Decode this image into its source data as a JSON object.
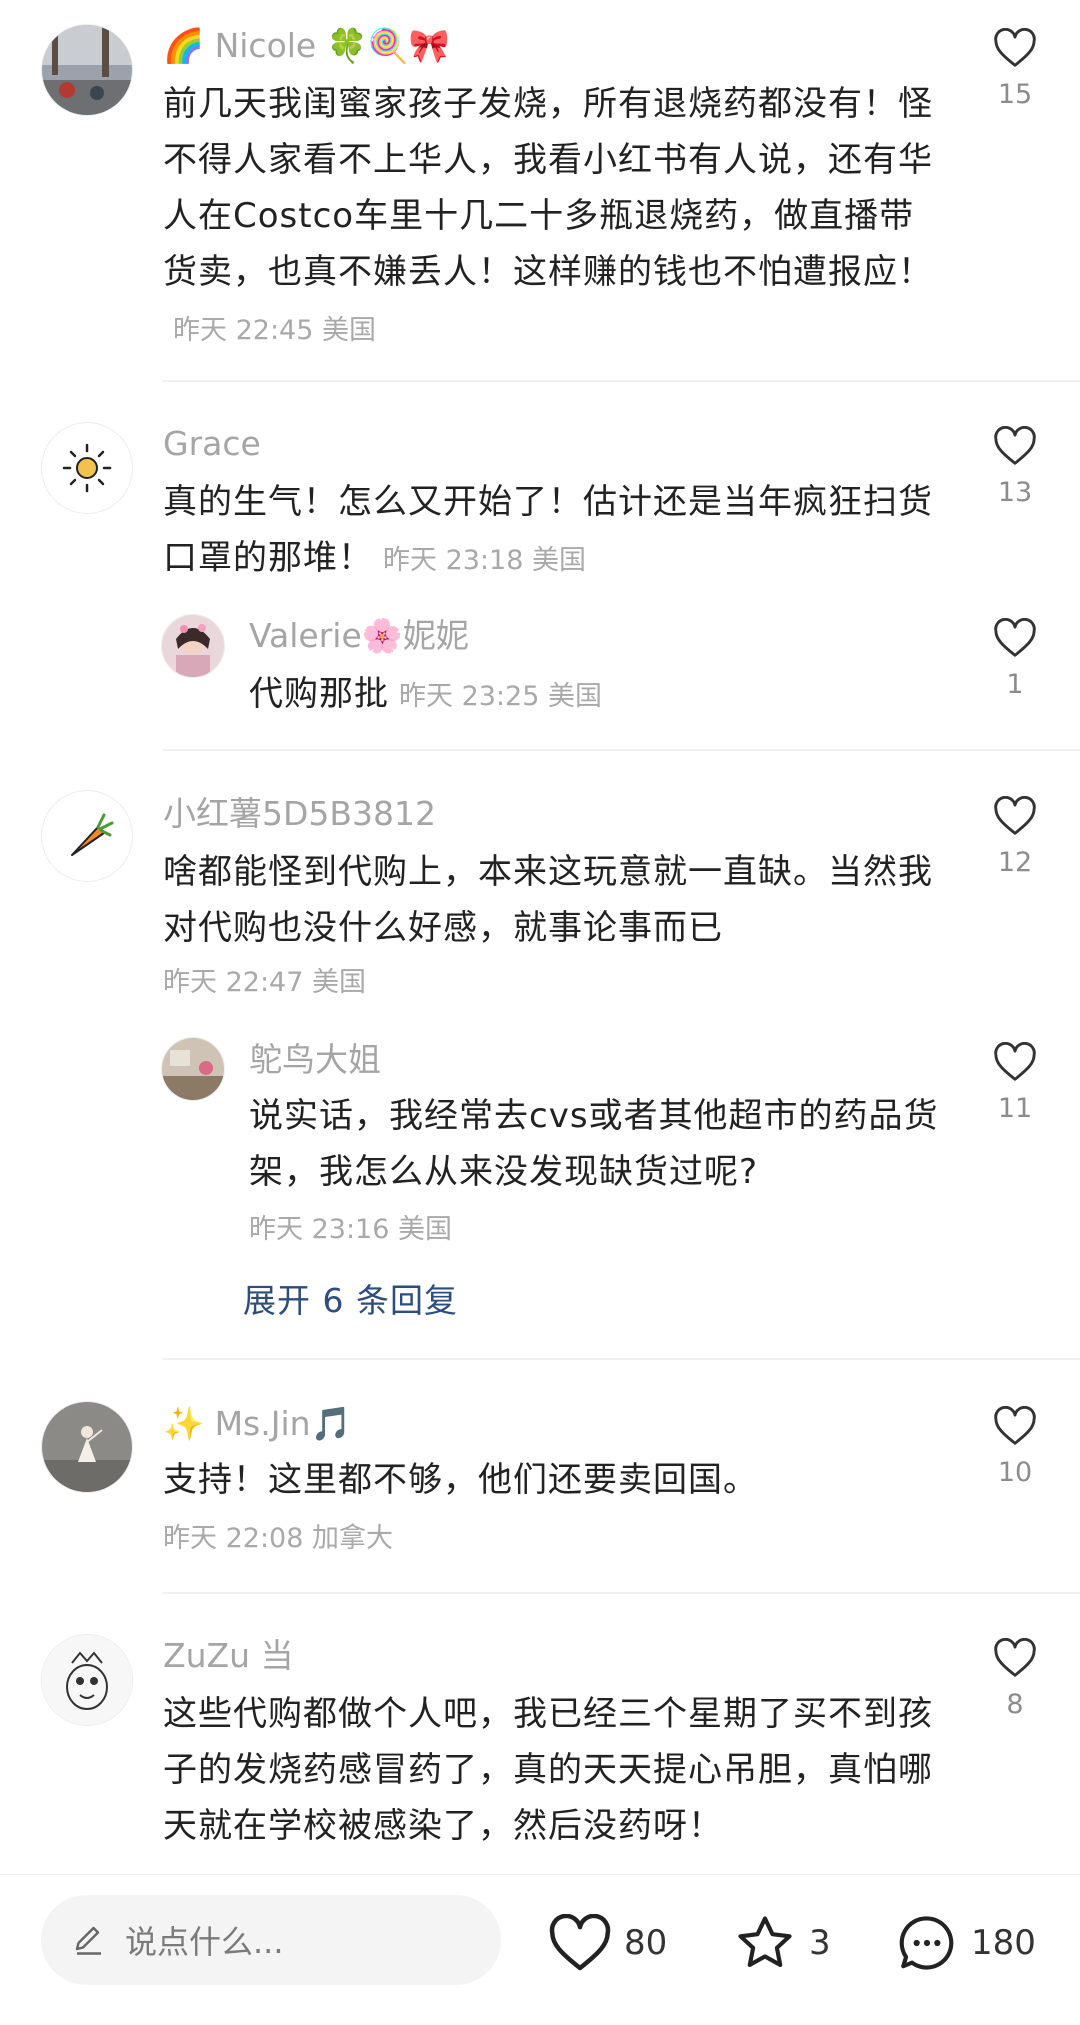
{
  "comments": [
    {
      "author": "🌈 Nicole 🍀🍭🎀",
      "text": "前几天我闺蜜家孩子发烧，所有退烧药都没有！怪不得人家看不上华人，我看小红书有人说，还有华人在Costco车里十几二十多瓶退烧药，做直播带货卖，也真不嫌丢人！这样赚的钱也不怕遭报应！",
      "time": "昨天 22:45 美国",
      "likes": "15",
      "avatar_icon": "street-photo"
    },
    {
      "author": "Grace",
      "text": "真的生气！怎么又开始了！估计还是当年疯狂扫货口罩的那堆！",
      "time": "昨天 23:18 美国",
      "likes": "13",
      "avatar_icon": "sun-icon"
    },
    {
      "author": "Valerie🌸妮妮",
      "text": "代购那批",
      "time": "昨天 23:25 美国",
      "likes": "1",
      "avatar_icon": "girl-photo"
    },
    {
      "author": "小红薯5D5B3812",
      "text": "啥都能怪到代购上，本来这玩意就一直缺。当然我对代购也没什么好感，就事论事而已",
      "time": "昨天 22:47 美国",
      "likes": "12",
      "avatar_icon": "carrot-icon"
    },
    {
      "author": "鸵鸟大姐",
      "text": "说实话，我经常去cvs或者其他超市的药品货架，我怎么从来没发现缺货过呢?",
      "time": "昨天 23:16 美国",
      "likes": "11",
      "avatar_icon": "room-photo"
    },
    {
      "author": "✨ Ms.Jin🎵",
      "text": "支持！这里都不够，他们还要卖回国。",
      "time": "昨天 22:08 加拿大",
      "likes": "10",
      "avatar_icon": "dancer-photo"
    },
    {
      "author": "ZuZu 当",
      "text": "这些代购都做个人吧，我已经三个星期了买不到孩子的发烧药感冒药了，真的天天提心吊胆，真怕哪天就在学校被感染了，然后没药呀！",
      "time": "",
      "likes": "8",
      "avatar_icon": "cartoon-sketch"
    }
  ],
  "expand_replies": "展开 6 条回复",
  "bottom_bar": {
    "input_placeholder": "说点什么...",
    "likes": "80",
    "stars": "3",
    "comments": "180"
  },
  "colors": {
    "author": "#a5a5a5",
    "meta": "#a9a9a9",
    "link": "#2e4d7c"
  }
}
